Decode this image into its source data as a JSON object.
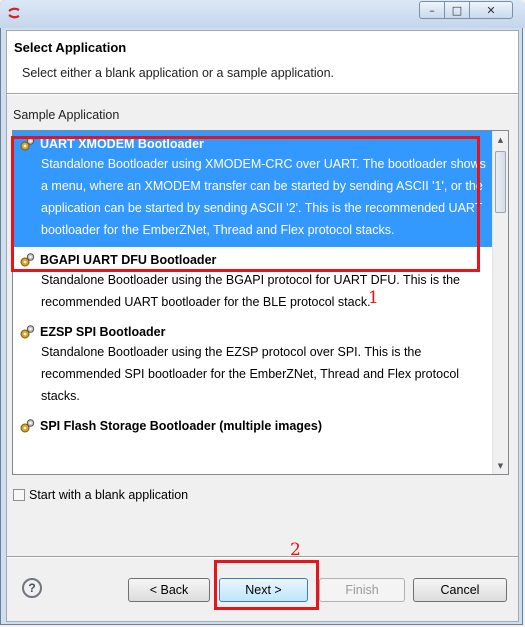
{
  "window": {
    "minimize_glyph": "–",
    "maximize_glyph": "□",
    "close_glyph": "✕",
    "icon": "app-logo-icon"
  },
  "header": {
    "title": "Select Application",
    "description": "Select either a blank application or a sample application."
  },
  "group": {
    "label": "Sample Application"
  },
  "list": {
    "items": [
      {
        "name": "UART XMODEM Bootloader",
        "description": "Standalone Bootloader using XMODEM-CRC over UART. The bootloader shows a menu, where an XMODEM transfer can be started by sending ASCII '1', or the application can be started by sending ASCII '2'. This is the recommended UART bootloader for the EmberZNet, Thread and Flex protocol stacks.",
        "selected": true,
        "icon": "gear-icon"
      },
      {
        "name": "BGAPI UART DFU Bootloader",
        "description": "Standalone Bootloader using the BGAPI protocol for UART DFU. This is the recommended UART bootloader for the BLE protocol stack.",
        "selected": false,
        "icon": "gear-icon"
      },
      {
        "name": "EZSP SPI Bootloader",
        "description": "Standalone Bootloader using the EZSP protocol over SPI. This is the recommended SPI bootloader for the EmberZNet, Thread and Flex protocol stacks.",
        "selected": false,
        "icon": "gear-icon"
      },
      {
        "name": "SPI Flash Storage Bootloader (multiple images)",
        "description": "",
        "selected": false,
        "icon": "gear-icon"
      }
    ]
  },
  "checkbox": {
    "label": "Start with a blank application",
    "checked": false
  },
  "buttons": {
    "help": "?",
    "back": "< Back",
    "next": "Next >",
    "finish": "Finish",
    "cancel": "Cancel"
  },
  "annotations": {
    "n1": "1",
    "n2": "2",
    "color": "#e8141b"
  },
  "colors": {
    "selection": "#3399ff"
  }
}
